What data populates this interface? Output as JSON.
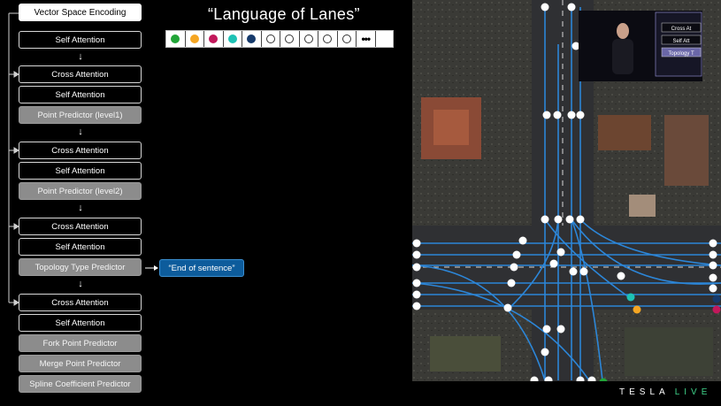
{
  "slide": {
    "title": "“Language of Lanes”",
    "end_of_sentence": "“End of sentence”"
  },
  "blocks": [
    {
      "label": "Vector Space Encoding",
      "style": "white"
    },
    {
      "label": "Self Attention",
      "style": "dark"
    },
    {
      "label": "Cross Attention",
      "style": "dark"
    },
    {
      "label": "Self Attention",
      "style": "dark"
    },
    {
      "label": "Point Predictor (level1)",
      "style": "gray"
    },
    {
      "label": "Cross Attention",
      "style": "dark"
    },
    {
      "label": "Self Attention",
      "style": "dark"
    },
    {
      "label": "Point Predictor (level2)",
      "style": "gray"
    },
    {
      "label": "Cross Attention",
      "style": "dark"
    },
    {
      "label": "Self Attention",
      "style": "dark"
    },
    {
      "label": "Topology Type Predictor",
      "style": "gray"
    },
    {
      "label": "Cross Attention",
      "style": "dark"
    },
    {
      "label": "Self Attention",
      "style": "dark"
    },
    {
      "label": "Fork Point Predictor",
      "style": "gray"
    },
    {
      "label": "Merge Point Predictor",
      "style": "gray"
    },
    {
      "label": "Spline Coefficient Predictor",
      "style": "gray"
    }
  ],
  "tokens": {
    "colors": [
      "#22a538",
      "#f5a623",
      "#c2185b",
      "#1ec2b5",
      "#163a6b"
    ],
    "empty_count": 5,
    "more": "•••"
  },
  "inset_video": {
    "labels": [
      "Cross At",
      "Self Att",
      "Topology T"
    ]
  },
  "brand": {
    "name": "TESLA",
    "live": "LIVE"
  },
  "colors": {
    "lane_line": "#2c86d8",
    "node": "#ffffff",
    "eos_fill": "#0d5c9c"
  }
}
